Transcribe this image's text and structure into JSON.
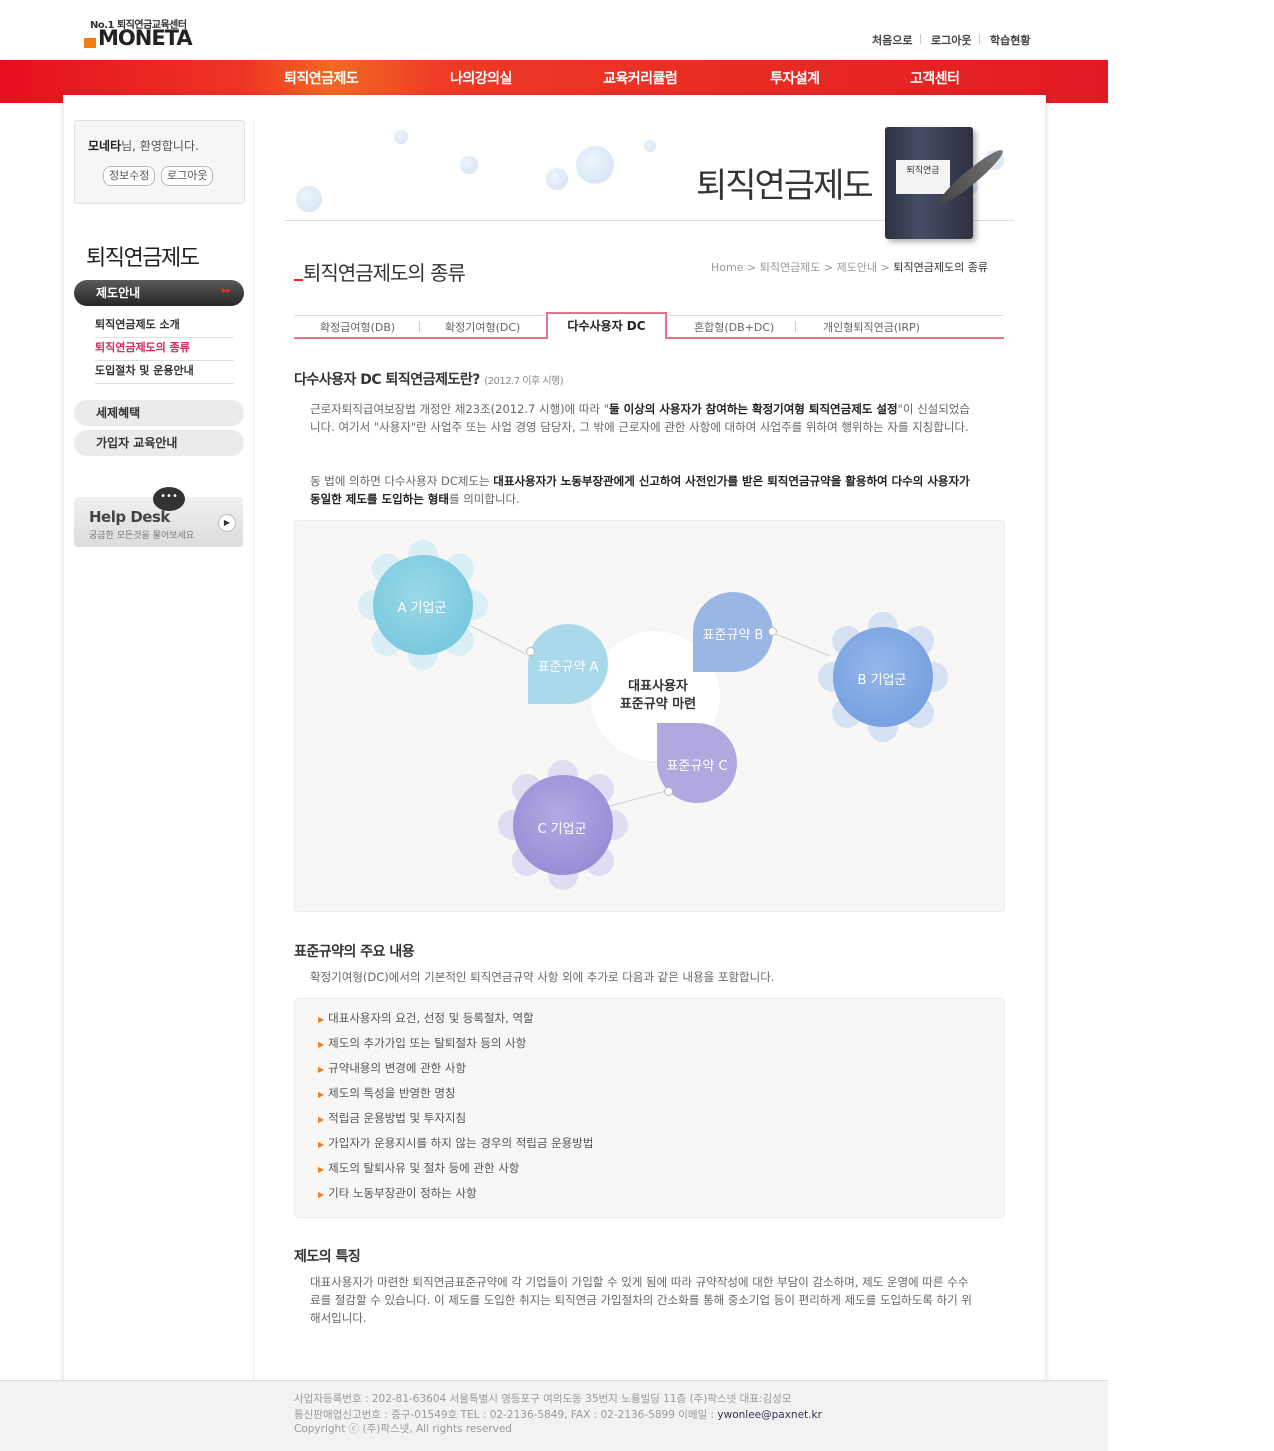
{
  "header": {
    "logo_top": "No.1 퇴직연금교육센터",
    "logo_main": "MONETA",
    "util_links": [
      "처음으로",
      "로그아웃",
      "학습현황"
    ]
  },
  "gnb": [
    "퇴직연금제도",
    "나의강의실",
    "교육커리큘럼",
    "투자설계",
    "고객센터"
  ],
  "sidebar": {
    "welcome_name": "모네타",
    "welcome_suffix": "님, 환영합니다.",
    "buttons": [
      "정보수정",
      "로그아웃"
    ],
    "title": "퇴직연금제도",
    "active_menu": "제도안내",
    "sub_items": [
      "퇴직연금제도 소개",
      "퇴직연금제도의 종류",
      "도입절차 및 운용안내"
    ],
    "other_menus": [
      "세제혜택",
      "가입자 교육안내"
    ],
    "helpdesk_title": "Help Desk",
    "helpdesk_sub": "궁금한 모든것을 물어보세요",
    "helpdesk_bubble": "•••"
  },
  "banner": {
    "title": "퇴직연금제도",
    "book_label": "퇴직연금"
  },
  "page": {
    "title": "퇴직연금제도의 종류",
    "breadcrumb": [
      "Home",
      "퇴직연금제도",
      "제도안내",
      "퇴직연금제도의 종류"
    ]
  },
  "tabs": [
    "확정급여형(DB)",
    "확정기여형(DC)",
    "다수사용자 DC",
    "혼합형(DB+DC)",
    "개인형퇴직연금(IRP)"
  ],
  "section1": {
    "heading": "다수사용자 DC 퇴직연금제도란?",
    "heading_note": "(2012.7 이후 시행)",
    "p1_a": "근로자퇴직급여보장법 개정안 제23조(2012.7 시행)에 따라 \"",
    "p1_b": "둘 이상의 사용자가 참여하는 확정기여형 퇴직연금제도 설정",
    "p1_c": "\"이 신설되었습니다. 여기서 \"사용자\"란 사업주 또는 사업 경영 담당자, 그 밖에 근로자에 관한 사항에 대하여 사업주를 위하여 행위하는 자를 지칭합니다.",
    "p2_a": "동 법에 의하면 다수사용자 DC제도는 ",
    "p2_b": "대표사용자가 노동부장관에게 신고하여 사전인가를 받은 퇴직연금규약을 활용하여 다수의 사용자가 동일한 제도를 도입하는 형태",
    "p2_c": "를 의미합니다."
  },
  "diagram": {
    "center_line1": "대표사용자",
    "center_line2": "표준규약 마련",
    "groups": [
      "A 기업군",
      "B 기업군",
      "C 기업군"
    ],
    "rules": [
      "표준규약 A",
      "표준규약 B",
      "표준규약 C"
    ],
    "colors": {
      "a": "#7fcbe0",
      "b": "#7fa6e0",
      "c": "#9b8fd6"
    }
  },
  "section2": {
    "heading": "표준규약의 주요 내용",
    "intro": "확정기여형(DC)에서의 기본적인 퇴직연금규약 사항 외에 추가로 다음과 같은 내용을 포함합니다.",
    "items": [
      "대표사용자의 요건, 선정 및 등록절차, 역할",
      "제도의 추가가입 또는 탈퇴절차 등의 사항",
      "규약내용의 변경에 관한 사항",
      "제도의 특성을 반영한 명칭",
      "적립금 운용방법 및 투자지침",
      "가입자가 운용지시를 하지 않는 경우의 적립금 운용방법",
      "제도의 탈퇴사유 및 절차 등에 관한 사항",
      "기타 노동부장관이 정하는 사항"
    ]
  },
  "section3": {
    "heading": "제도의 특징",
    "text": "대표사용자가 마련한 퇴직연금표준규약에 각 기업들이 가입할 수 있게 됨에 따라 규약작성에 대한 부담이 감소하며, 제도 운영에 따른 수수료를 절감할 수 있습니다. 이 제도를 도입한 취지는 퇴직연금 가입절차의 간소화를 통해 중소기업 등이 편리하게 제도를 도입하도록 하기 위해서입니다."
  },
  "footer": {
    "line1": "사업자등록번호 : 202-81-63604 서울특별시 영등포구 여의도동 35번지 노룡빌딩 11층 (주)팍스넷 대표:김성모",
    "line2": "통신판매업신고번호 : 중구-01549호 TEL : 02-2136-5849, FAX : 02-2136-5899 이메일 : ",
    "email": "ywonlee@paxnet.kr",
    "line3": "Copyright ⓒ (주)팍스넷, All rights reserved"
  }
}
